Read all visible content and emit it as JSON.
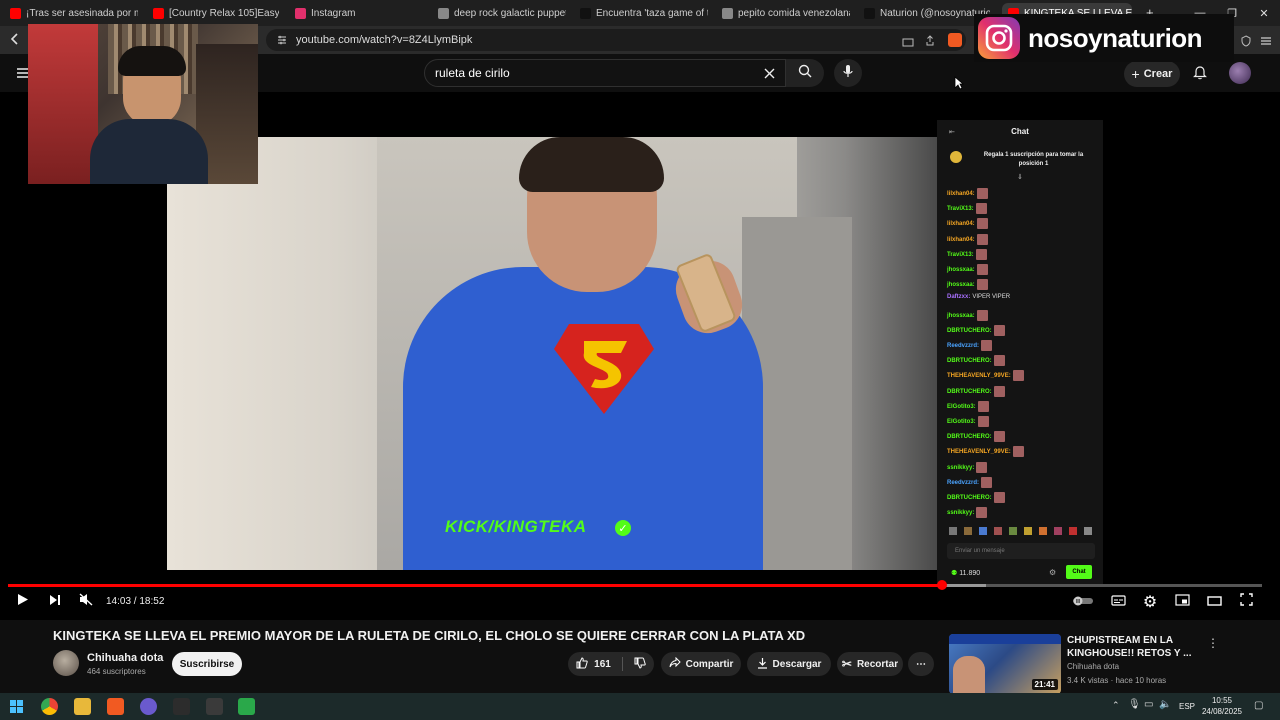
{
  "browser": {
    "tabs": [
      {
        "label": "¡Tras ser asesinada por mi herm",
        "color": "#ff0000"
      },
      {
        "label": "[Country Relax 105]Easyge",
        "color": "#ff0000"
      },
      {
        "label": "Instagram",
        "color": "#e1306c"
      },
      {
        "label": "deep rock galactic puppet - Bu",
        "color": "#888888"
      },
      {
        "label": "Encuentra 'taza game of throne",
        "color": "#111111"
      },
      {
        "label": "pepito comida venezolana - Bú",
        "color": "#888888"
      },
      {
        "label": "Naturion (@nosoynaturion)",
        "color": "#111111"
      },
      {
        "label": "KINGTEKA SE LLEVA EL PRE",
        "color": "#ff0000"
      }
    ],
    "url": "youtube.com/watch?v=8Z4LlymBipk",
    "window_controls": {
      "minimize": "—",
      "restore": "❐",
      "close": "✕"
    }
  },
  "youtube_header": {
    "search_value": "ruleta de cirilo",
    "create_label": "Crear"
  },
  "player": {
    "overlay_text": "KICK/KINGTEKA",
    "time_current": "14:03",
    "time_total": "18:52",
    "time_display": "14:03 / 18:52",
    "progress": 0.745,
    "buffered": 0.78
  },
  "chat": {
    "header": "Chat",
    "pinned": "Regala 1 suscripción para tomar la posición 1",
    "lines": [
      {
        "user": "lilxhan04:",
        "color": "#f5a623",
        "text": ""
      },
      {
        "user": "TraviX13:",
        "color": "#53fc18",
        "text": ""
      },
      {
        "user": "lilxhan04:",
        "color": "#f5a623",
        "text": ""
      },
      {
        "user": "lilxhan04:",
        "color": "#f5a623",
        "text": ""
      },
      {
        "user": "TraviX13:",
        "color": "#53fc18",
        "text": ""
      },
      {
        "user": "jhossxaa:",
        "color": "#53fc18",
        "text": ""
      },
      {
        "user": "jhossxaa:",
        "color": "#53fc18",
        "text": ""
      },
      {
        "user": "Daftzxx:",
        "color": "#a970ff",
        "text": "VIPER VIPER"
      },
      {
        "user": "jhossxaa:",
        "color": "#53fc18",
        "text": ""
      },
      {
        "user": "DBRTUCHERO:",
        "color": "#53fc18",
        "text": ""
      },
      {
        "user": "Reedvzzrd:",
        "color": "#4aa3ff",
        "text": ""
      },
      {
        "user": "DBRTUCHERO:",
        "color": "#53fc18",
        "text": ""
      },
      {
        "user": "THEHEAVENLY_99VE:",
        "color": "#f5a623",
        "text": ""
      },
      {
        "user": "DBRTUCHERO:",
        "color": "#53fc18",
        "text": ""
      },
      {
        "user": "ElGotito3:",
        "color": "#53fc18",
        "text": ""
      },
      {
        "user": "ElGotito3:",
        "color": "#53fc18",
        "text": ""
      },
      {
        "user": "DBRTUCHERO:",
        "color": "#53fc18",
        "text": ""
      },
      {
        "user": "THEHEAVENLY_99VE:",
        "color": "#f5a623",
        "text": ""
      },
      {
        "user": "ssnikkyy:",
        "color": "#53fc18",
        "text": ""
      },
      {
        "user": "Reedvzzrd:",
        "color": "#4aa3ff",
        "text": ""
      },
      {
        "user": "DBRTUCHERO:",
        "color": "#53fc18",
        "text": ""
      },
      {
        "user": "ssnikkyy:",
        "color": "#53fc18",
        "text": ""
      }
    ],
    "input_placeholder": "Enviar un mensaje",
    "viewer_count": "11.890",
    "send_label": "Chat"
  },
  "video": {
    "title": "KINGTEKA SE LLEVA EL PREMIO MAYOR DE LA RULETA DE CIRILO, EL CHOLO SE QUIERE CERRAR CON LA PLATA XD",
    "channel": "Chihuaha dota",
    "subscribers": "464 suscriptores",
    "subscribe_label": "Suscribirse",
    "likes": "161",
    "share_label": "Compartir",
    "download_label": "Descargar",
    "clip_label": "Recortar"
  },
  "recommended": {
    "title_line1": "CHUPISTREAM EN LA",
    "title_line2": "KINGHOUSE!! RETOS Y ...",
    "channel": "Chihuaha dota",
    "meta": "3.4 K vistas · hace 10 horas",
    "duration": "21:41"
  },
  "overlay": {
    "instagram_handle": "nosoynaturion"
  },
  "taskbar": {
    "language": "ESP",
    "time": "10:55",
    "date": "24/08/2025"
  }
}
